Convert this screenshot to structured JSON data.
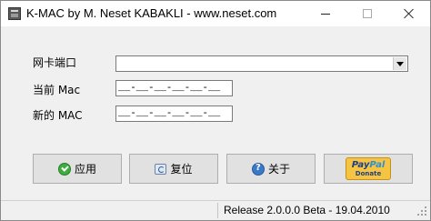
{
  "window": {
    "title": "K-MAC by M. Neset KABAKLI  -  www.neset.com"
  },
  "form": {
    "port_label": "网卡端口",
    "port_value": "",
    "current_label": "当前 Mac",
    "current_value": "__-__-__-__-__-__",
    "new_label": "新的 MAC",
    "new_value": "__-__-__-__-__-__"
  },
  "buttons": {
    "apply": "应用",
    "reset": "复位",
    "about": "关于",
    "paypal_pay": "Pay",
    "paypal_pal": "Pal",
    "paypal_donate": "Donate"
  },
  "status": {
    "left": "",
    "right": "Release 2.0.0.0 Beta - 19.04.2010"
  }
}
